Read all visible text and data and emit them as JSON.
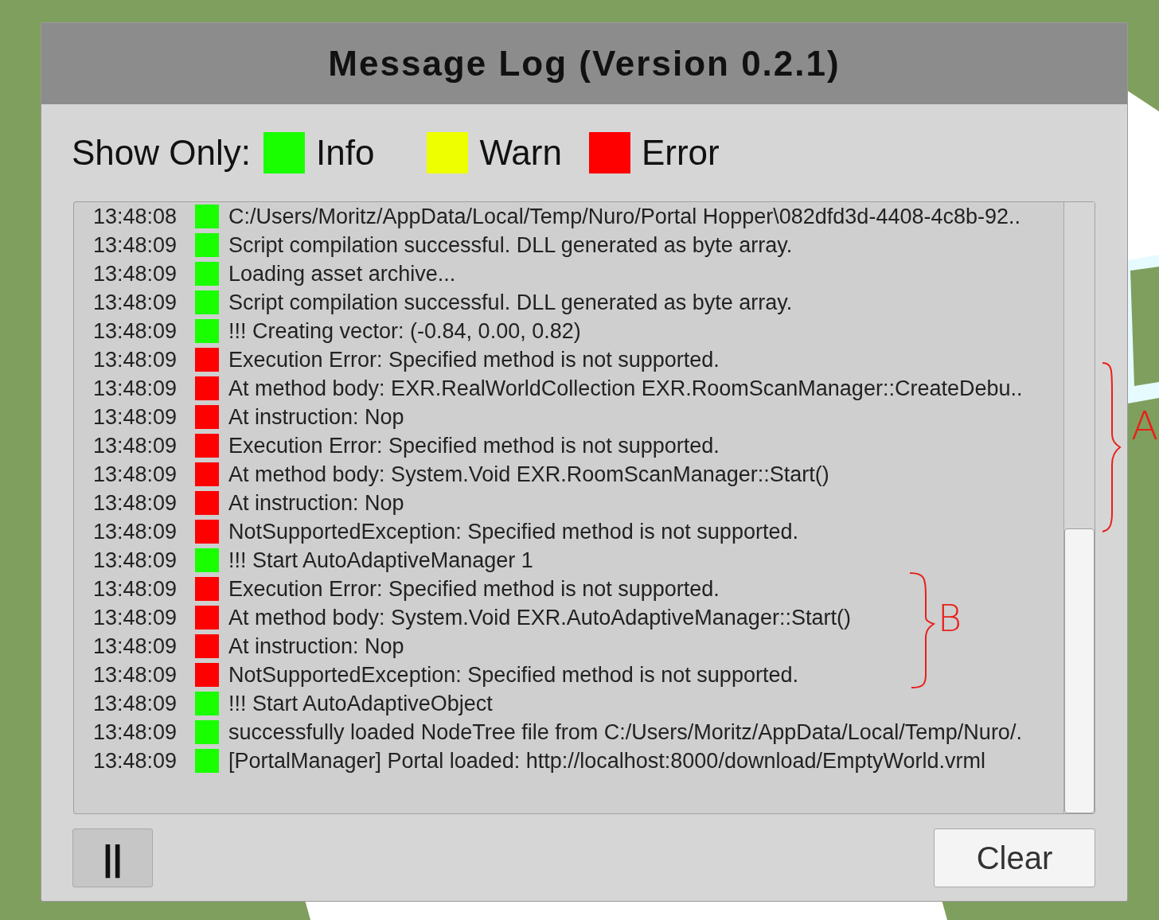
{
  "window": {
    "title": "Message Log (Version 0.2.1)"
  },
  "filter": {
    "label": "Show Only:",
    "options": [
      {
        "label": "Info",
        "kind": "info",
        "selected": true
      },
      {
        "label": "Warn",
        "kind": "warn",
        "selected": true
      },
      {
        "label": "Error",
        "kind": "error",
        "selected": true
      }
    ]
  },
  "log": [
    {
      "time": "13:48:08",
      "kind": "info",
      "message": "C:/Users/Moritz/AppData/Local/Temp/Nuro/Portal Hopper\\082dfd3d-4408-4c8b-92.."
    },
    {
      "time": "13:48:09",
      "kind": "info",
      "message": "Script compilation successful. DLL generated as byte array."
    },
    {
      "time": "13:48:09",
      "kind": "info",
      "message": "Loading asset archive..."
    },
    {
      "time": "13:48:09",
      "kind": "info",
      "message": "Script compilation successful. DLL generated as byte array."
    },
    {
      "time": "13:48:09",
      "kind": "info",
      "message": "!!! Creating vector: (-0.84, 0.00, 0.82)"
    },
    {
      "time": "13:48:09",
      "kind": "error",
      "message": "Execution Error: Specified method is not supported."
    },
    {
      "time": "13:48:09",
      "kind": "error",
      "message": "At method body: EXR.RealWorldCollection EXR.RoomScanManager::CreateDebu.."
    },
    {
      "time": "13:48:09",
      "kind": "error",
      "message": "At instruction: Nop"
    },
    {
      "time": "13:48:09",
      "kind": "error",
      "message": "Execution Error: Specified method is not supported."
    },
    {
      "time": "13:48:09",
      "kind": "error",
      "message": "At method body: System.Void EXR.RoomScanManager::Start()"
    },
    {
      "time": "13:48:09",
      "kind": "error",
      "message": "At instruction: Nop"
    },
    {
      "time": "13:48:09",
      "kind": "error",
      "message": "NotSupportedException: Specified method is not supported."
    },
    {
      "time": "13:48:09",
      "kind": "info",
      "message": "!!! Start AutoAdaptiveManager 1"
    },
    {
      "time": "13:48:09",
      "kind": "error",
      "message": "Execution Error: Specified method is not supported."
    },
    {
      "time": "13:48:09",
      "kind": "error",
      "message": "At method body: System.Void EXR.AutoAdaptiveManager::Start()"
    },
    {
      "time": "13:48:09",
      "kind": "error",
      "message": "At instruction: Nop"
    },
    {
      "time": "13:48:09",
      "kind": "error",
      "message": "NotSupportedException: Specified method is not supported."
    },
    {
      "time": "13:48:09",
      "kind": "info",
      "message": "!!! Start AutoAdaptiveObject"
    },
    {
      "time": "13:48:09",
      "kind": "info",
      "message": "successfully loaded NodeTree file from C:/Users/Moritz/AppData/Local/Temp/Nuro/."
    },
    {
      "time": "13:48:09",
      "kind": "info",
      "message": "[PortalManager] Portal loaded: http://localhost:8000/download/EmptyWorld.vrml"
    }
  ],
  "annotations": [
    {
      "label": "A"
    },
    {
      "label": "B"
    }
  ],
  "buttons": {
    "pause": "||",
    "clear": "Clear"
  }
}
